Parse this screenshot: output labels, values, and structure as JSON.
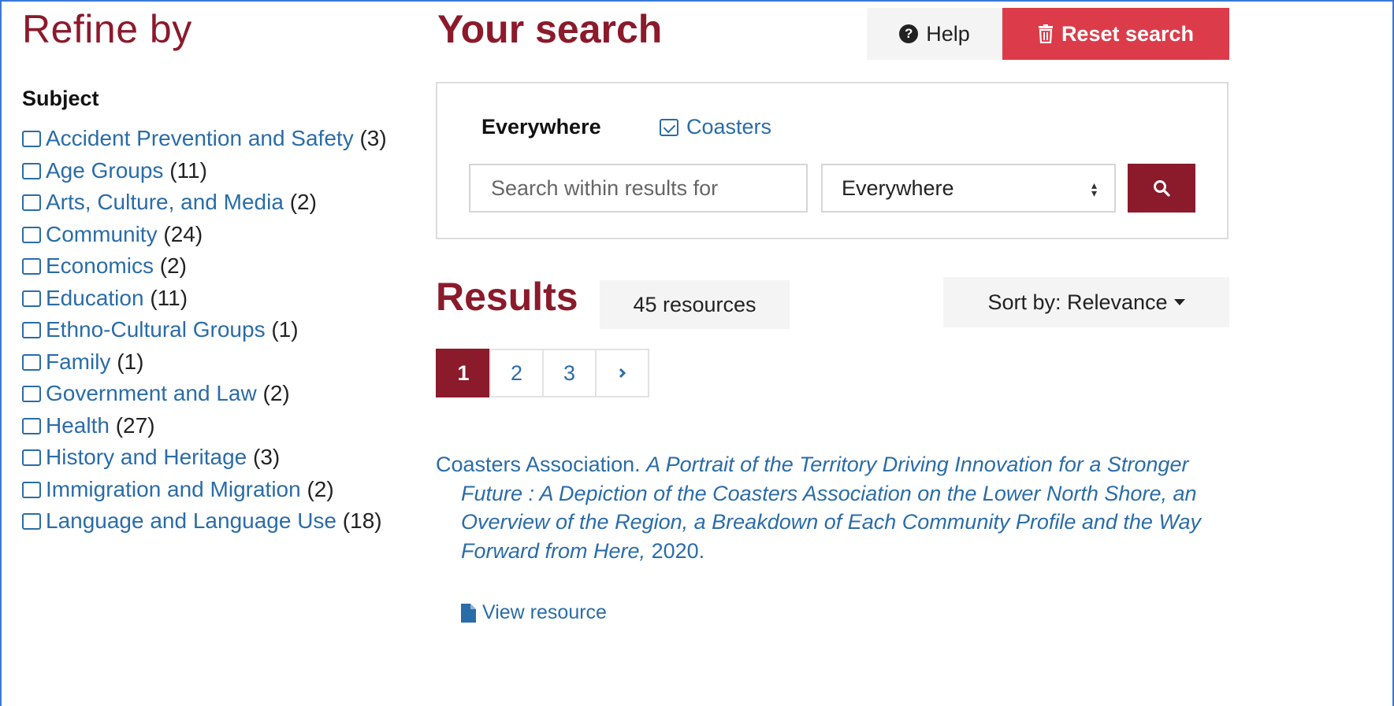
{
  "sidebar": {
    "title": "Refine by",
    "subject_heading": "Subject",
    "facets": [
      {
        "label": "Accident Prevention and Safety",
        "count": "(3)"
      },
      {
        "label": "Age Groups",
        "count": "(11)"
      },
      {
        "label": "Arts, Culture, and Media",
        "count": "(2)"
      },
      {
        "label": "Community",
        "count": "(24)"
      },
      {
        "label": "Economics",
        "count": "(2)"
      },
      {
        "label": "Education",
        "count": "(11)"
      },
      {
        "label": "Ethno-Cultural Groups",
        "count": "(1)"
      },
      {
        "label": "Family",
        "count": "(1)"
      },
      {
        "label": "Government and Law",
        "count": "(2)"
      },
      {
        "label": "Health",
        "count": "(27)"
      },
      {
        "label": "History and Heritage",
        "count": "(3)"
      },
      {
        "label": "Immigration and Migration",
        "count": "(2)"
      },
      {
        "label": "Language and Language Use",
        "count": "(18)"
      }
    ]
  },
  "search": {
    "title": "Your search",
    "help_label": "Help",
    "reset_label": "Reset search",
    "scope_label": "Everywhere",
    "active_filter": "Coasters",
    "input_placeholder": "Search within results for",
    "input_value": "",
    "scope_select_value": "Everywhere"
  },
  "results": {
    "title": "Results",
    "count_label": "45 resources",
    "sort_label": "Sort by: Relevance",
    "pages": [
      "1",
      "2",
      "3"
    ],
    "next_label": "›",
    "items": [
      {
        "author": "Coasters Association.",
        "title": "A Portrait of the Territory Driving Innovation for a Stronger Future : A Depiction of the Coasters Association on the Lower North Shore, an Overview of the Region, a Breakdown of Each Community Profile and the Way Forward from Here,",
        "year": "2020.",
        "link_label": "View resource"
      }
    ]
  },
  "colors": {
    "brand": "#8b1a2b",
    "link": "#2a6ca8",
    "danger": "#dc3c4a",
    "frame": "#3a78d6"
  }
}
